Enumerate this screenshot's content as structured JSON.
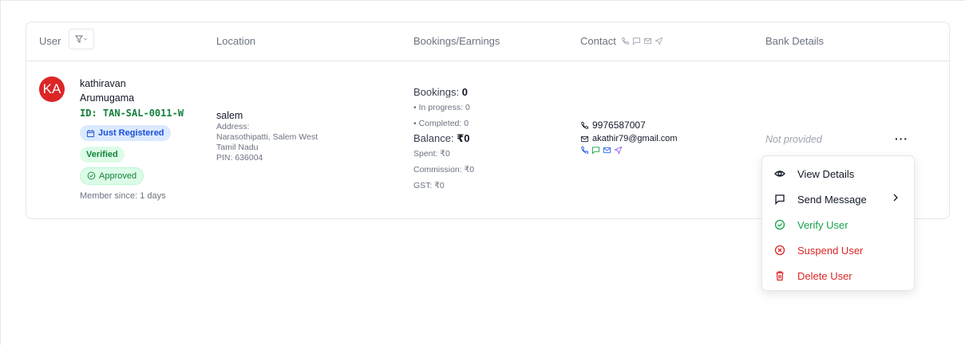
{
  "table": {
    "headers": {
      "user": "User",
      "location": "Location",
      "bookings": "Bookings/Earnings",
      "contact": "Contact",
      "bank": "Bank Details"
    },
    "rows": [
      {
        "avatar_initials": "KA",
        "avatar_color": "#dc2626",
        "name_line1": "kathiravan",
        "name_line2": "Arumugama",
        "id": "ID: TAN-SAL-0011-W",
        "badge_registered": "Just Registered",
        "badge_verified": "Verified",
        "badge_approved": "Approved",
        "member_since": "Member since: 1 days",
        "location": {
          "city": "salem",
          "address_label": "Address:",
          "address_line1": "Narasothipatti, Salem West",
          "address_line2": "Tamil Nadu",
          "pin": "PIN: 636004"
        },
        "bookings": {
          "label": "Bookings:",
          "count": "0",
          "in_progress": "• In progress: 0",
          "completed": "• Completed: 0",
          "balance_label": "Balance:",
          "balance": "₹0",
          "spent": "Spent: ₹0",
          "commission": "Commission: ₹0",
          "gst": "GST: ₹0"
        },
        "contact": {
          "phone": "9976587007",
          "email": "akathir79@gmail.com"
        },
        "bank": "Not provided",
        "more": "···"
      }
    ]
  },
  "action_menu": {
    "items": [
      {
        "label": "View Details",
        "icon": "eye-icon"
      },
      {
        "label": "Send Message",
        "icon": "message-icon"
      },
      {
        "label": "Verify User",
        "icon": "check-circle-icon"
      },
      {
        "label": "Suspend User",
        "icon": "x-circle-icon"
      },
      {
        "label": "Delete User",
        "icon": "trash-icon"
      }
    ]
  },
  "colors": {
    "green": "#16a34a",
    "red": "#dc2626",
    "blue": "#1d4ed8",
    "purple": "#8b5cf6"
  }
}
